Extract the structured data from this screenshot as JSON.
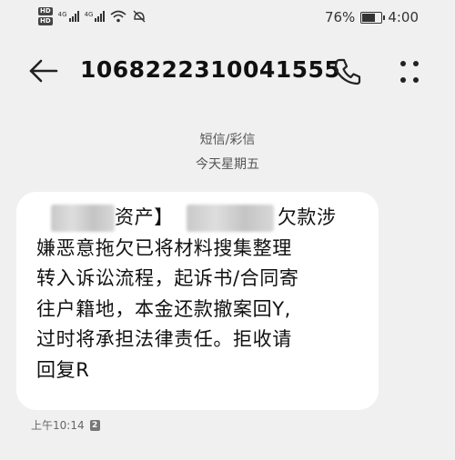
{
  "status_bar": {
    "hd1": "HD",
    "hd2": "HD",
    "net1": "4G",
    "net2": "4G",
    "battery_percent": "76%",
    "battery_level": 0.76,
    "time": "4:00",
    "icons": [
      "signal-icon",
      "wifi-icon",
      "alarm-off-icon",
      "battery-icon"
    ]
  },
  "header": {
    "title": "1068222310041555",
    "back_icon": "back-arrow-icon",
    "call_icon": "phone-icon",
    "more_icon": "more-options-icon"
  },
  "conversation": {
    "channel": "短信/彩信",
    "day": "今天星期五"
  },
  "message": {
    "line1_a": "资产】",
    "line1_b": "欠款涉",
    "line2": "嫌恶意拖欠已将材料搜集整理",
    "line3": "转入诉讼流程，起诉书/合同寄",
    "line4": "往户籍地，本金还款撤案回Y,",
    "line5": "过时将承担法律责任。拒收请",
    "line6": "回复R",
    "time": "上午10:14",
    "sim": "2"
  },
  "colors": {
    "background": "#f0f0f0",
    "bubble": "#ffffff",
    "text": "#111111",
    "meta_text": "#666666"
  }
}
